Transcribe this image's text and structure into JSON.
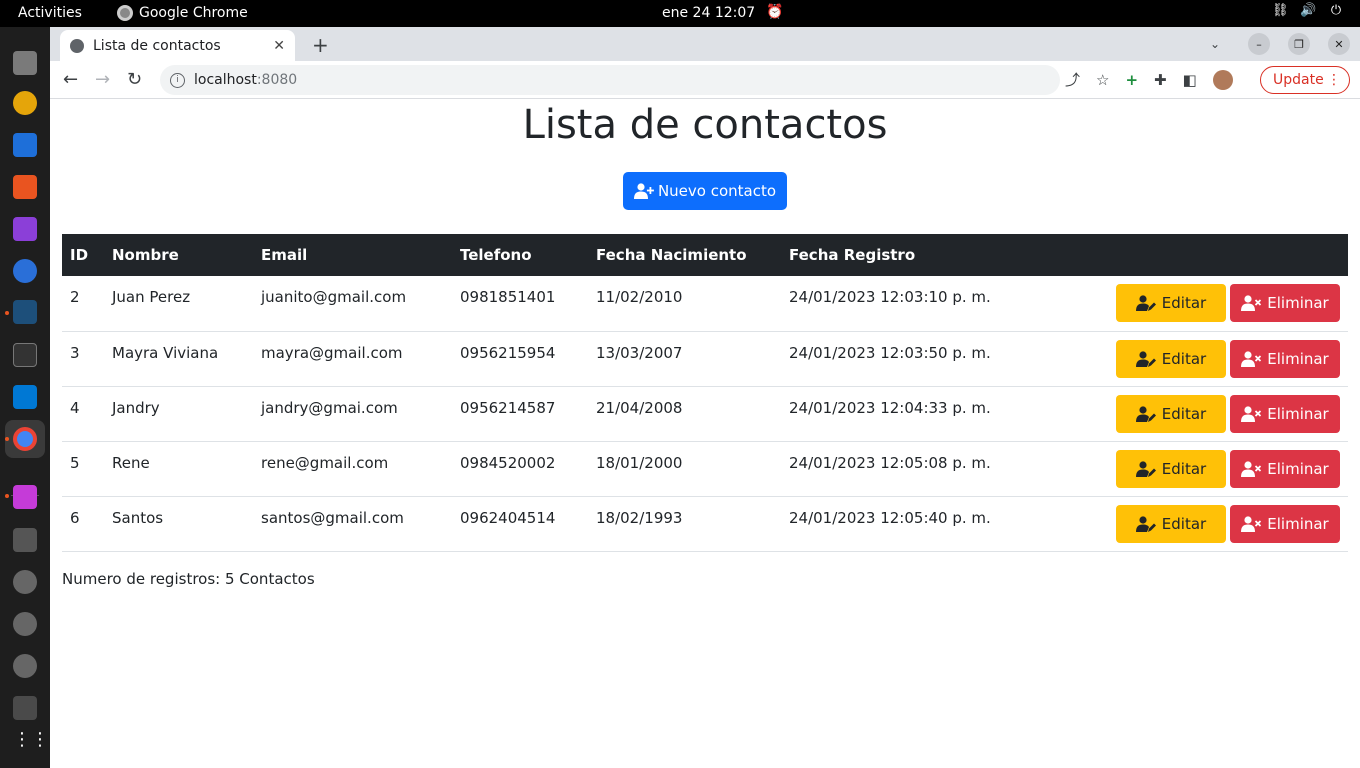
{
  "system": {
    "activities": "Activities",
    "app_name": "Google Chrome",
    "clock": "ene 24  12:07"
  },
  "browser": {
    "tab_title": "Lista de contactos",
    "url_host": "localhost",
    "url_port": ":8080",
    "update_label": "Update"
  },
  "page": {
    "title": "Lista de contactos",
    "new_button": "Nuevo contacto",
    "columns": [
      "ID",
      "Nombre",
      "Email",
      "Telefono",
      "Fecha Nacimiento",
      "Fecha Registro"
    ],
    "rows": [
      {
        "id": "2",
        "nombre": "Juan Perez",
        "email": "juanito@gmail.com",
        "telefono": "0981851401",
        "nacimiento": "11/02/2010",
        "registro": "24/01/2023 12:03:10 p. m."
      },
      {
        "id": "3",
        "nombre": "Mayra Viviana",
        "email": "mayra@gmail.com",
        "telefono": "0956215954",
        "nacimiento": "13/03/2007",
        "registro": "24/01/2023 12:03:50 p. m."
      },
      {
        "id": "4",
        "nombre": "Jandry",
        "email": "jandry@gmai.com",
        "telefono": "0956214587",
        "nacimiento": "21/04/2008",
        "registro": "24/01/2023 12:04:33 p. m."
      },
      {
        "id": "5",
        "nombre": "Rene",
        "email": "rene@gmail.com",
        "telefono": "0984520002",
        "nacimiento": "18/01/2000",
        "registro": "24/01/2023 12:05:08 p. m."
      },
      {
        "id": "6",
        "nombre": "Santos",
        "email": "santos@gmail.com",
        "telefono": "0962404514",
        "nacimiento": "18/02/1993",
        "registro": "24/01/2023 12:05:40 p. m."
      }
    ],
    "edit_label": "Editar",
    "delete_label": "Eliminar",
    "footer": "Numero de registros: 5 Contactos"
  },
  "colors": {
    "primary": "#0d6efd",
    "warning": "#ffc107",
    "danger": "#dc3545",
    "table_header": "#212529"
  },
  "icons": [
    "user-plus-icon",
    "user-edit-icon",
    "user-remove-icon",
    "globe-icon",
    "info-icon",
    "share-icon",
    "star-icon",
    "extensions-icon",
    "sidepanel-icon"
  ]
}
